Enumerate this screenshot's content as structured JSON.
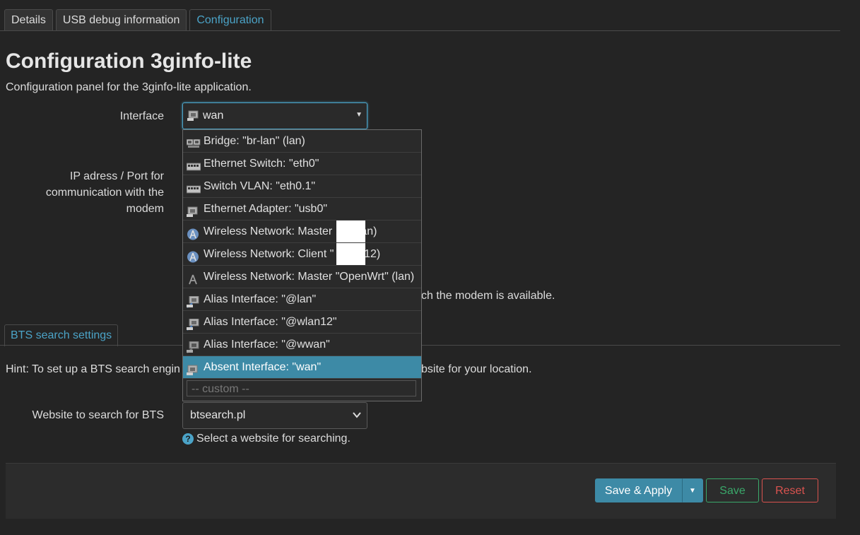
{
  "tabs": [
    {
      "label": "Details",
      "active": false
    },
    {
      "label": "USB debug information",
      "active": false
    },
    {
      "label": "Configuration",
      "active": true
    }
  ],
  "page": {
    "title": "Configuration 3ginfo-lite",
    "description": "Configuration panel for the 3ginfo-lite application."
  },
  "interface_field": {
    "label": "Interface",
    "value": "wan",
    "icon": "ethernet-adapter-icon"
  },
  "ip_field": {
    "label": "IP adress / Port for communication with the modem"
  },
  "dropdown": {
    "options": [
      {
        "label": "Bridge: \"br-lan\" (lan)",
        "icon": "bridge-icon"
      },
      {
        "label": "Ethernet Switch: \"eth0\"",
        "icon": "switch-icon"
      },
      {
        "label": "Switch VLAN: \"eth0.1\"",
        "icon": "switch-icon"
      },
      {
        "label": "Ethernet Adapter: \"usb0\"",
        "icon": "ethernet-adapter-icon"
      },
      {
        "label": "Wireless Network: Master       11\" (lan)",
        "icon": "wifi-icon"
      },
      {
        "label": "Wireless Network: Client \"         (wlan12)",
        "icon": "wifi-icon"
      },
      {
        "label": "Wireless Network: Master \"OpenWrt\" (lan)",
        "icon": "wifi-disabled-icon"
      },
      {
        "label": "Alias Interface: \"@lan\"",
        "icon": "alias-icon"
      },
      {
        "label": "Alias Interface: \"@wlan12\"",
        "icon": "alias-icon"
      },
      {
        "label": "Alias Interface: \"@wwan\"",
        "icon": "alias-icon"
      },
      {
        "label": "Absent Interface: \"wan\"",
        "icon": "ethernet-adapter-icon",
        "selected": true
      }
    ],
    "custom_placeholder": "-- custom --"
  },
  "modem_desc_visible": "ch the modem is available.",
  "bts_section": {
    "tab_label": "BTS search settings",
    "hint_left": "Hint: To set up a BTS search engin",
    "hint_right": "bsite for your location.",
    "website_label": "Website to search for BTS",
    "website_value": "btsearch.pl",
    "website_help": "Select a website for searching."
  },
  "footer": {
    "save_apply": "Save & Apply",
    "save": "Save",
    "reset": "Reset"
  },
  "colors": {
    "accent": "#4ba3c7",
    "selected_bg": "#3d8aa6",
    "save": "#3aa86a",
    "reset": "#d9534f",
    "background": "#242424"
  }
}
